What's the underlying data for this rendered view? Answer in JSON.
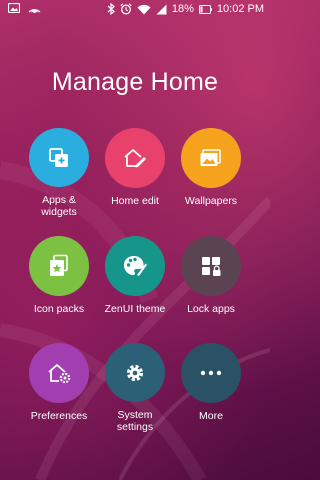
{
  "status_bar": {
    "battery": "18%",
    "time": "10:02 PM",
    "icons": [
      "image-notification-icon",
      "cast-icon",
      "bluetooth-icon",
      "alarm-icon",
      "wifi-icon",
      "signal-icon",
      "battery-icon"
    ]
  },
  "header": {
    "title": "Manage Home"
  },
  "tiles": [
    {
      "label": "Apps &\nwidgets",
      "icon": "apps-widgets-icon",
      "color": "#2aaee0"
    },
    {
      "label": "Home edit",
      "icon": "home-edit-icon",
      "color": "#e8416b"
    },
    {
      "label": "Wallpapers",
      "icon": "wallpapers-icon",
      "color": "#f5a31c"
    },
    {
      "label": "Icon packs",
      "icon": "icon-packs-icon",
      "color": "#7cc142"
    },
    {
      "label": "ZenUI theme",
      "icon": "palette-icon",
      "color": "#16968a"
    },
    {
      "label": "Lock apps",
      "icon": "lock-apps-icon",
      "color": "#5a4452"
    },
    {
      "label": "Preferences",
      "icon": "preferences-icon",
      "color": "#a23fb0"
    },
    {
      "label": "System\nsettings",
      "icon": "gear-icon",
      "color": "#2b6077"
    },
    {
      "label": "More",
      "icon": "more-icon",
      "color": "#2a5166"
    }
  ]
}
